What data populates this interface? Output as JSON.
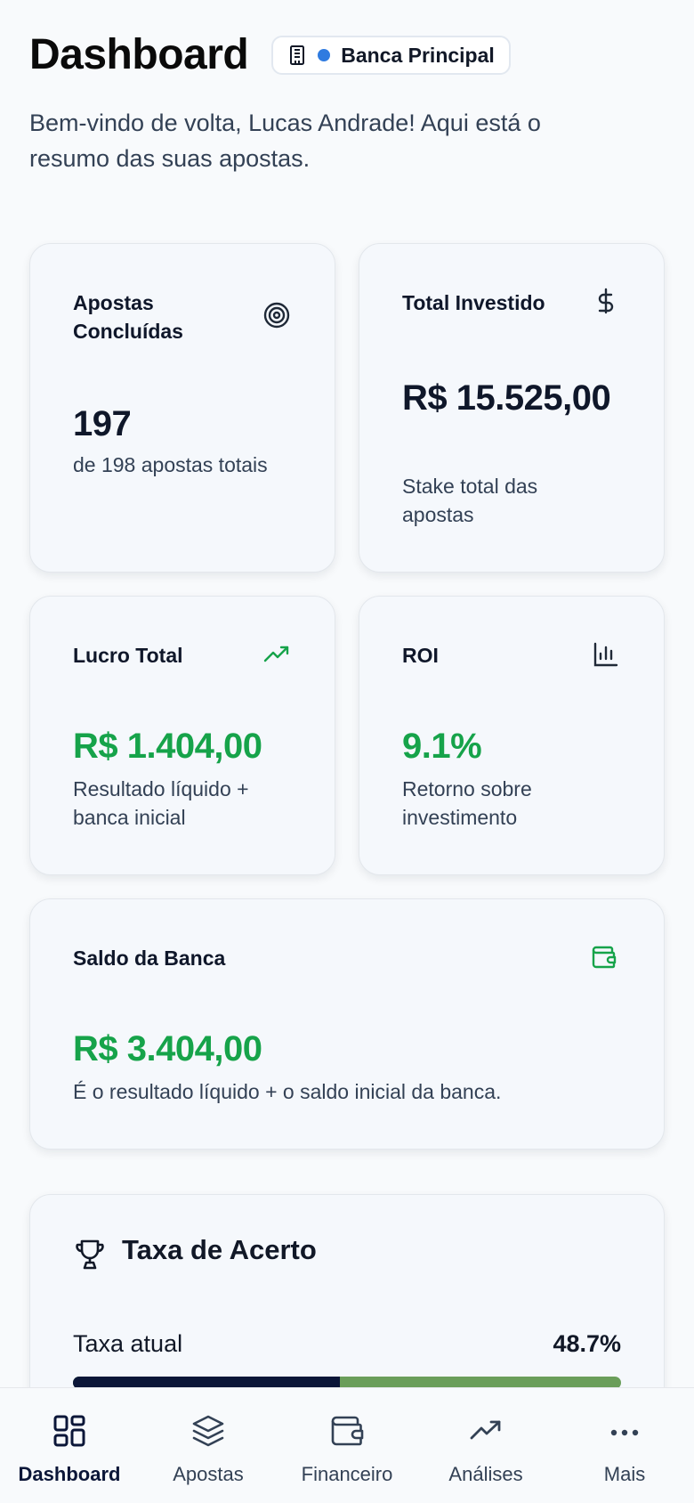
{
  "header": {
    "title": "Dashboard",
    "bank_label": "Banca Principal",
    "bank_dot_color": "#2f7be0",
    "subtitle": "Bem-vindo de volta, Lucas Andrade! Aqui está o resumo das suas apostas."
  },
  "cards": {
    "concluidas": {
      "label": "Apostas Concluídas",
      "value": "197",
      "desc": "de 198 apostas totais",
      "icon": "target-icon"
    },
    "investido": {
      "label": "Total Investido",
      "value": "R$ 15.525,00",
      "desc": "Stake total das apostas",
      "icon": "dollar-icon"
    },
    "lucro": {
      "label": "Lucro Total",
      "value": "R$ 1.404,00",
      "desc": "Resultado líquido + banca inicial",
      "icon": "trending-up-icon"
    },
    "roi": {
      "label": "ROI",
      "value": "9.1%",
      "desc": "Retorno sobre investimento",
      "icon": "bar-chart-icon"
    },
    "saldo": {
      "label": "Saldo da Banca",
      "value": "R$ 3.404,00",
      "desc": "É o resultado líquido + o saldo inicial da banca.",
      "icon": "wallet-icon"
    }
  },
  "taxa": {
    "title": "Taxa de Acerto",
    "row_label": "Taxa atual",
    "value": "48.7%",
    "progress_fraction": 0.487
  },
  "colors": {
    "positive": "#16a34a",
    "primary": "#0b1638",
    "progress_track": "#6a9e5a"
  },
  "nav": {
    "items": [
      {
        "label": "Dashboard",
        "icon": "grid-icon",
        "active": true
      },
      {
        "label": "Apostas",
        "icon": "layers-icon",
        "active": false
      },
      {
        "label": "Financeiro",
        "icon": "wallet-icon",
        "active": false
      },
      {
        "label": "Análises",
        "icon": "trending-up-icon",
        "active": false
      },
      {
        "label": "Mais",
        "icon": "more-icon",
        "active": false
      }
    ]
  }
}
